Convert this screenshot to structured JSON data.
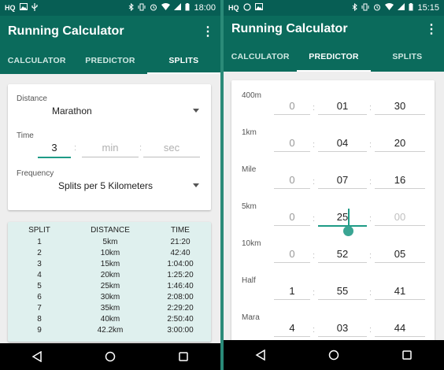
{
  "left": {
    "status": {
      "left_icons": [
        "hq-icon",
        "image-icon",
        "usb-icon"
      ],
      "hq": "HQ",
      "time": "18:00"
    },
    "app_title": "Running Calculator",
    "tabs": [
      {
        "label": "CALCULATOR"
      },
      {
        "label": "PREDICTOR"
      },
      {
        "label": "SPLITS"
      }
    ],
    "active_tab": "SPLITS",
    "form": {
      "distance_label": "Distance",
      "distance_value": "Marathon",
      "time_label": "Time",
      "time_hours": "3",
      "time_min_placeholder": "min",
      "time_sec_placeholder": "sec",
      "colon": ":",
      "frequency_label": "Frequency",
      "frequency_value": "Splits per 5 Kilometers"
    },
    "splits_table": {
      "headers": [
        "SPLIT",
        "DISTANCE",
        "TIME"
      ],
      "rows": [
        [
          "1",
          "5km",
          "21:20"
        ],
        [
          "2",
          "10km",
          "42:40"
        ],
        [
          "3",
          "15km",
          "1:04:00"
        ],
        [
          "4",
          "20km",
          "1:25:20"
        ],
        [
          "5",
          "25km",
          "1:46:40"
        ],
        [
          "6",
          "30km",
          "2:08:00"
        ],
        [
          "7",
          "35km",
          "2:29:20"
        ],
        [
          "8",
          "40km",
          "2:50:40"
        ],
        [
          "9",
          "42.2km",
          "3:00:00"
        ]
      ]
    }
  },
  "right": {
    "status": {
      "hq": "HQ",
      "time": "15:15"
    },
    "app_title": "Running Calculator",
    "tabs": [
      {
        "label": "CALCULATOR"
      },
      {
        "label": "PREDICTOR"
      },
      {
        "label": "SPLITS"
      }
    ],
    "active_tab": "PREDICTOR",
    "colon": ":",
    "rows": [
      {
        "label": "400m",
        "h": "0",
        "m": "01",
        "s": "30"
      },
      {
        "label": "1km",
        "h": "0",
        "m": "04",
        "s": "20"
      },
      {
        "label": "Mile",
        "h": "0",
        "m": "07",
        "s": "16"
      },
      {
        "label": "5km",
        "h": "0",
        "m": "25",
        "s": "00"
      },
      {
        "label": "10km",
        "h": "0",
        "m": "52",
        "s": "05"
      },
      {
        "label": "Half",
        "h": "1",
        "m": "55",
        "s": "41"
      },
      {
        "label": "Mara",
        "h": "4",
        "m": "03",
        "s": "44"
      }
    ]
  },
  "colors": {
    "status_bar": "#075e54",
    "app_bar": "#0b6b5c",
    "accent": "#1e9b86",
    "table_bg": "#dff0ee"
  }
}
